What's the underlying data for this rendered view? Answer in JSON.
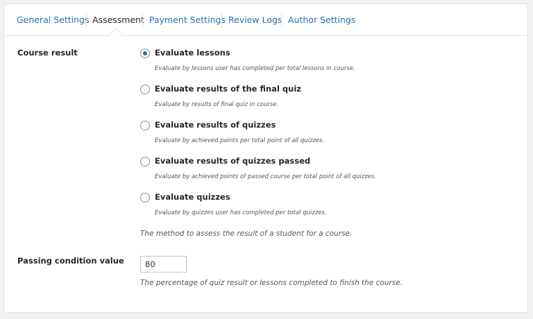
{
  "tabs": [
    {
      "label": "General Settings",
      "active": false
    },
    {
      "label": "Assessment",
      "active": true
    },
    {
      "label": "Payment Settings",
      "active": false
    },
    {
      "label": "Review Logs",
      "active": false
    },
    {
      "label": "Author Settings",
      "active": false
    }
  ],
  "course_result": {
    "label": "Course result",
    "options": [
      {
        "label": "Evaluate lessons",
        "description": "Evaluate by lessons user has completed per total lessons in course.",
        "checked": true
      },
      {
        "label": "Evaluate results of the final quiz",
        "description": "Evaluate by results of final quiz in course.",
        "checked": false
      },
      {
        "label": "Evaluate results of quizzes",
        "description": "Evaluate by achieved points per total point of all quizzes.",
        "checked": false
      },
      {
        "label": "Evaluate results of quizzes passed",
        "description": "Evaluate by achieved points of passed course per total point of all quizzes.",
        "checked": false
      },
      {
        "label": "Evaluate quizzes",
        "description": "Evaluate by quizzes user has completed per total quizzes.",
        "checked": false
      }
    ],
    "help": "The method to assess the result of a student for a course."
  },
  "passing_condition": {
    "label": "Passing condition value",
    "value": "80",
    "help": "The percentage of quiz result or lessons completed to finish the course."
  },
  "colors": {
    "link": "#2271b1",
    "text": "#23282d",
    "muted": "#50575e",
    "border": "#e2e4e7",
    "background": "#f1f1f1"
  }
}
